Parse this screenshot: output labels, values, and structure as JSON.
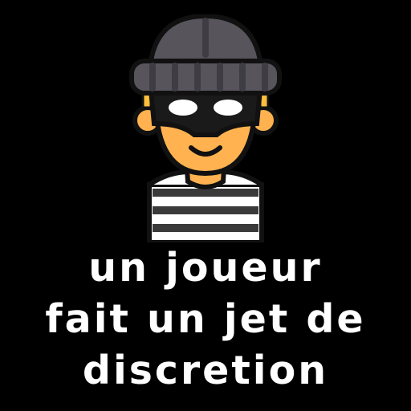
{
  "caption": {
    "line1": "un joueur",
    "line2": "fait un jet de",
    "line3": "discretion"
  },
  "illustration": {
    "icon": "thief-icon",
    "colors": {
      "beanie": "#57545c",
      "beanie_dark": "#3f3d44",
      "outline": "#111111",
      "skin": "#ffb24f",
      "mask": "#1a1a1a",
      "eyes": "#ffffff",
      "earring": "#ffbf3d",
      "shirt_light": "#ffffff",
      "shirt_dark": "#3a3a3a"
    }
  }
}
